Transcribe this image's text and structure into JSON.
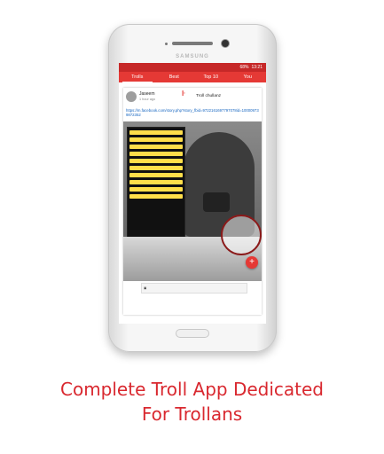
{
  "caption": [
    "Complete Troll App Dedicated",
    "For Trollans"
  ],
  "device": {
    "brand": "SAMSUNG"
  },
  "status": {
    "battery": "68%",
    "time": "13:21"
  },
  "tabs": [
    {
      "label": "Trolls"
    },
    {
      "label": "Best"
    },
    {
      "label": "Top 10"
    },
    {
      "label": "You"
    }
  ],
  "post": {
    "user": "Jaseem",
    "time": "1 hour ago",
    "group": "Troll chullanz",
    "link": "https://m.facebook.com/story.php?story_fbid=9722161697797078id=100009739872352"
  },
  "stamp": "Troll Chullanz",
  "colors": {
    "accent": "#e53935",
    "caption": "#d9282f"
  }
}
